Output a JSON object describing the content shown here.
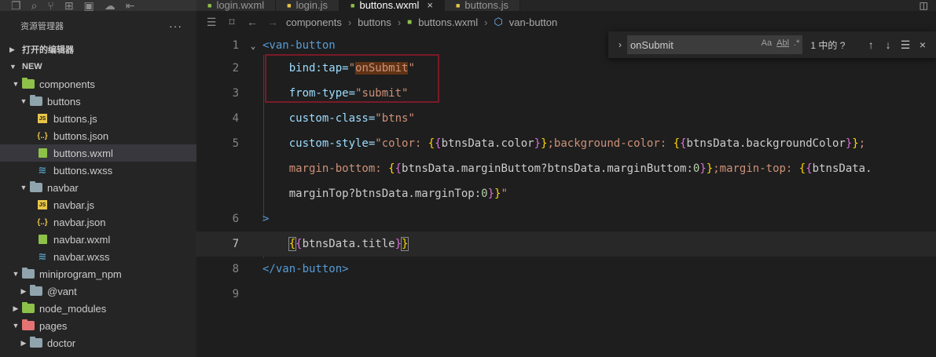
{
  "activity_icons": [
    "explorer-icon",
    "search-icon",
    "source-control-icon",
    "extensions-icon",
    "remote-icon",
    "debug-icon",
    "split-icon"
  ],
  "tabs": [
    {
      "label": "login.wxml",
      "type": "wxml",
      "active": false
    },
    {
      "label": "login.js",
      "type": "js",
      "active": false
    },
    {
      "label": "buttons.wxml",
      "type": "wxml",
      "active": true
    },
    {
      "label": "buttons.js",
      "type": "js",
      "active": false
    }
  ],
  "sidebar": {
    "title": "资源管理器",
    "more": "···",
    "open_editors": "打开的编辑器",
    "project": "NEW",
    "tree": [
      {
        "label": "components",
        "kind": "folder",
        "color": "#8dc149",
        "depth": 1,
        "open": true
      },
      {
        "label": "buttons",
        "kind": "folder",
        "color": "#90a4ae",
        "depth": 2,
        "open": true
      },
      {
        "label": "buttons.js",
        "kind": "js",
        "depth": 3
      },
      {
        "label": "buttons.json",
        "kind": "json",
        "depth": 3
      },
      {
        "label": "buttons.wxml",
        "kind": "wxml",
        "depth": 3,
        "selected": true
      },
      {
        "label": "buttons.wxss",
        "kind": "wxss",
        "depth": 3
      },
      {
        "label": "navbar",
        "kind": "folder",
        "color": "#90a4ae",
        "depth": 2,
        "open": true
      },
      {
        "label": "navbar.js",
        "kind": "js",
        "depth": 3
      },
      {
        "label": "navbar.json",
        "kind": "json",
        "depth": 3
      },
      {
        "label": "navbar.wxml",
        "kind": "wxml",
        "depth": 3
      },
      {
        "label": "navbar.wxss",
        "kind": "wxss",
        "depth": 3
      },
      {
        "label": "miniprogram_npm",
        "kind": "folder",
        "color": "#90a4ae",
        "depth": 1,
        "open": true
      },
      {
        "label": "@vant",
        "kind": "folder",
        "color": "#90a4ae",
        "depth": 2,
        "open": false
      },
      {
        "label": "node_modules",
        "kind": "folder",
        "color": "#8dc149",
        "depth": 1,
        "open": false
      },
      {
        "label": "pages",
        "kind": "folder",
        "color": "#e57373",
        "depth": 1,
        "open": true
      },
      {
        "label": "doctor",
        "kind": "folder",
        "color": "#90a4ae",
        "depth": 2,
        "open": false
      }
    ]
  },
  "breadcrumb": [
    "components",
    "buttons",
    "buttons.wxml",
    "van-button"
  ],
  "find": {
    "query": "onSubmit",
    "match_case": "Aa",
    "whole_word": "Abl",
    "regex": ".*",
    "count": "1 中的 ?"
  },
  "editor": {
    "current_line": 7,
    "line_numbers": [
      "1",
      "2",
      "3",
      "4",
      "5",
      "",
      "",
      "6",
      "7",
      "8",
      "9"
    ],
    "l1_tag": "<van-button",
    "l2_attr": "bind:tap=",
    "l2_val": "onSubmit",
    "l3_attr": "from-type=",
    "l3_val": "\"submit\"",
    "l4_attr": "custom-class=",
    "l4_val": "\"btns\"",
    "l5_attr": "custom-style=",
    "l5_a": "\"color: ",
    "l5_b": "btnsData.color",
    "l5_c": ";background-color: ",
    "l5_d": "btnsData.backgroundColor",
    "l5_e": ";",
    "l5b_a": "margin-bottom: ",
    "l5b_b": "btnsData.marginButtom?btnsData.marginButtom:",
    "l5b_num": "0",
    "l5b_c": ";margin-top: ",
    "l5b_d": "btnsData.",
    "l5c_a": "marginTop?btnsData.marginTop:",
    "l5c_num": "0",
    "l5c_end": "\"",
    "l6": ">",
    "l7_expr": "btnsData.title",
    "l8_tag": "</van-button>"
  }
}
